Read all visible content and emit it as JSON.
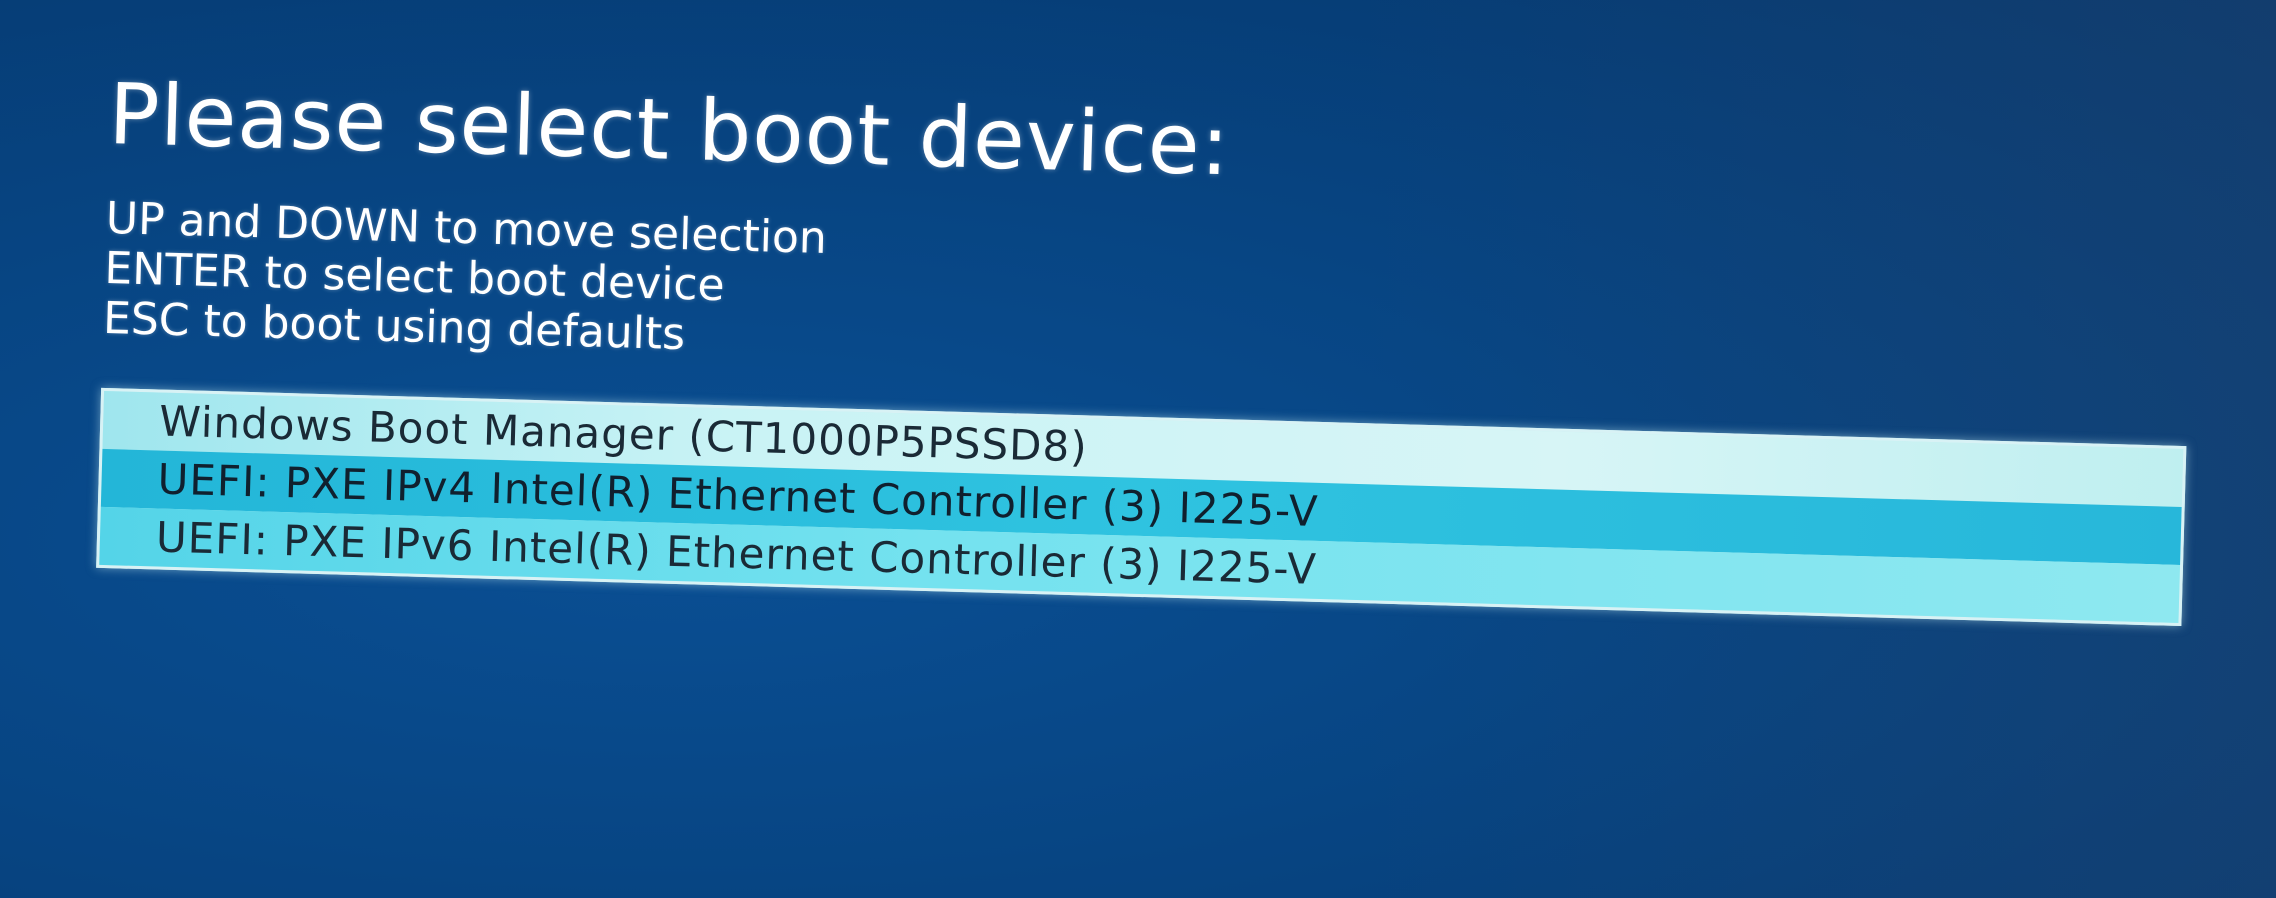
{
  "title": "Please select boot device:",
  "instructions": [
    "UP and DOWN to move selection",
    "ENTER to select boot device",
    "ESC to boot using defaults"
  ],
  "boot_devices": [
    {
      "label": "Windows Boot Manager (CT1000P5PSSD8)"
    },
    {
      "label": "UEFI: PXE IPv4 Intel(R) Ethernet Controller (3) I225-V"
    },
    {
      "label": "UEFI: PXE IPv6 Intel(R) Ethernet Controller (3) I225-V"
    }
  ],
  "colors": {
    "background": "#074583",
    "list_background": "#bfeff0",
    "selected_row": "#2fc3e0",
    "text_on_list": "#1a2a36"
  }
}
